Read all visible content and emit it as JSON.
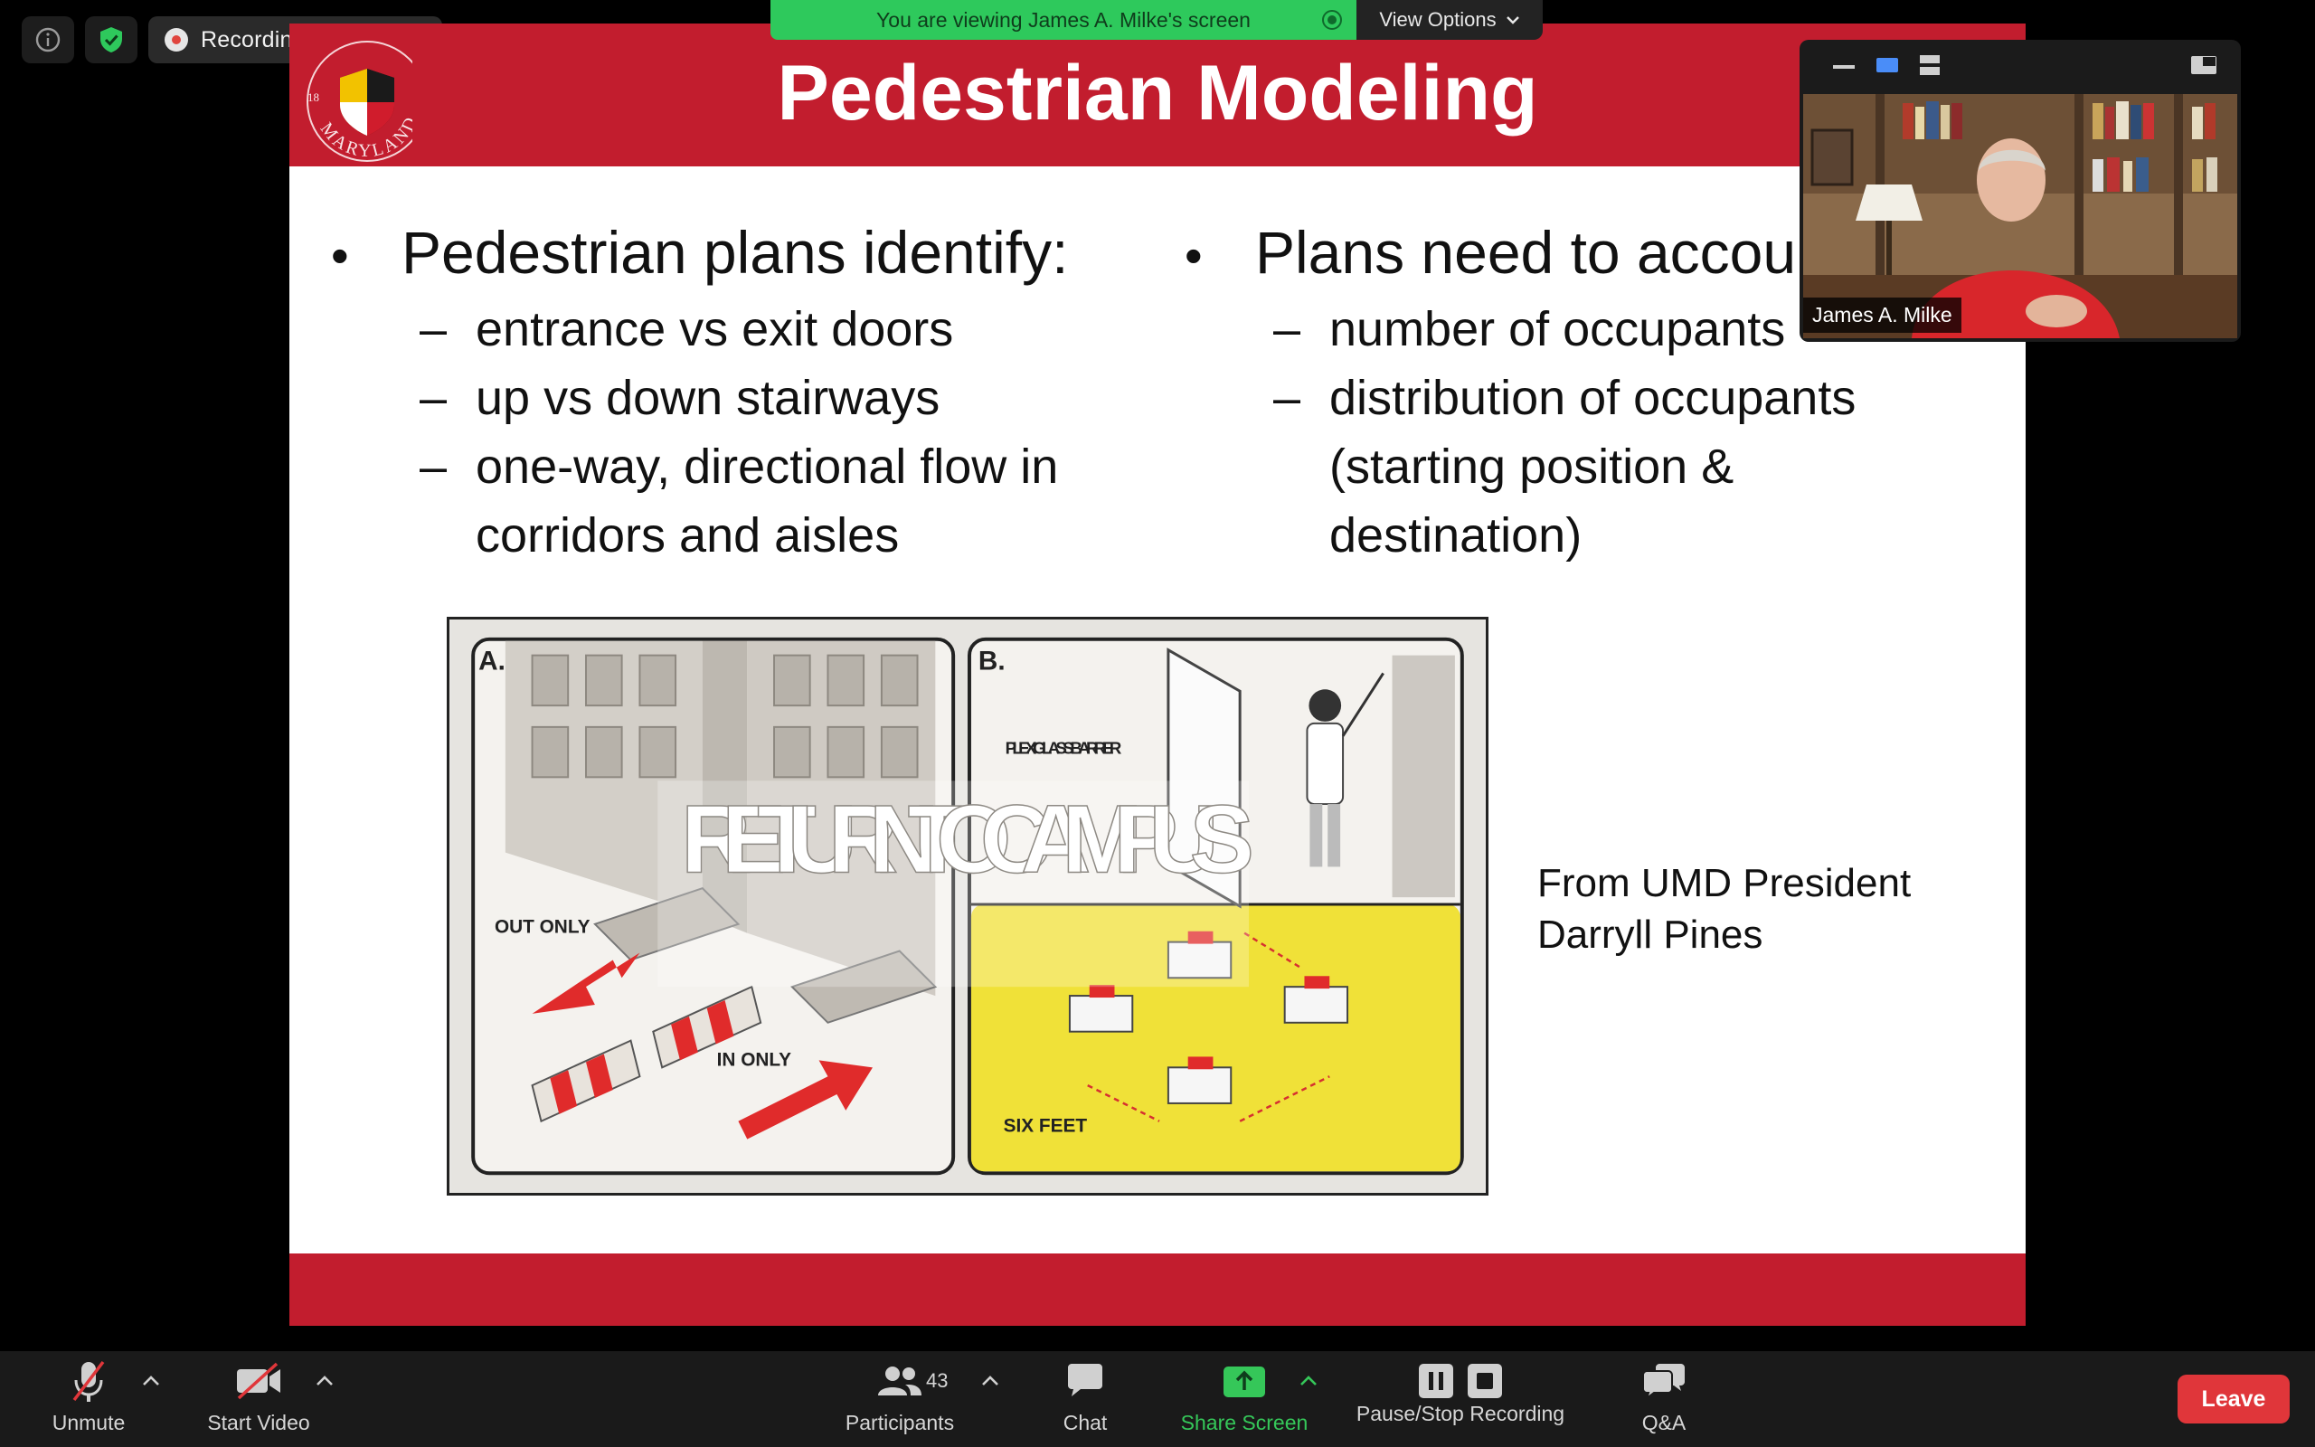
{
  "meeting": {
    "recording_label": "Recording...",
    "viewing_banner": "You are viewing James A. Milke's screen",
    "view_options_label": "View Options"
  },
  "slide": {
    "title": "Pedestrian Modeling",
    "left_column": {
      "bullet": "Pedestrian plans identify:",
      "items": [
        "entrance vs exit doors",
        "up vs down stairways",
        "one-way, directional flow in corridors and aisles"
      ]
    },
    "right_column": {
      "bullet": "Plans need to accou",
      "items": [
        "number of occupants",
        "distribution of occupants (starting position & destination)"
      ]
    },
    "illustration": {
      "overlay_text": "RETURN TO CAMPUS",
      "panel_a_label": "A.",
      "panel_b_label": "B.",
      "labels": [
        "PLEXIGLASS BARRIER",
        "OUT ONLY",
        "IN ONLY",
        "SIX FEET"
      ]
    },
    "caption": "From UMD President Darryll Pines",
    "seal_text": "MARYLAND"
  },
  "video": {
    "participant_name": "James A. Milke"
  },
  "toolbar": {
    "unmute": "Unmute",
    "start_video": "Start Video",
    "participants": "Participants",
    "participants_count": "43",
    "chat": "Chat",
    "share_screen": "Share Screen",
    "recording_controls": "Pause/Stop Recording",
    "qa": "Q&A",
    "leave": "Leave"
  },
  "colors": {
    "brand_red": "#c21d2e",
    "banner_green": "#2ec95c",
    "leave_red": "#e0363a",
    "share_green": "#35c759"
  }
}
